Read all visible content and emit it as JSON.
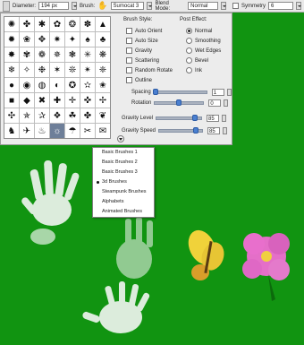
{
  "toolbar": {
    "diameter_label": "Diameter:",
    "diameter_value": "194 px",
    "brush_label": "Brush:",
    "brush_value": "Sumocat 3",
    "blend_label": "Blend Mode:",
    "blend_value": "Normal",
    "symmetry_label": "Symmetry",
    "symmetry_value": "6"
  },
  "panel": {
    "brush_style_label": "Brush Style:",
    "post_effect_label": "Post Effect:",
    "brush_style_options": [
      "Auto Orient",
      "Auto Size",
      "Gravity",
      "Scattering",
      "Random Rotate",
      "Outline"
    ],
    "post_effect_options": [
      "Normal",
      "Smoothing",
      "Wet Edges",
      "Bevel",
      "Ink"
    ],
    "post_effect_selected": "Normal",
    "sliders": [
      {
        "label": "Spacing",
        "value": "1",
        "fraction": 0.02
      },
      {
        "label": "Rotation",
        "value": "0",
        "fraction": 0.5
      },
      {
        "label": "Gravity Level",
        "value": "85",
        "fraction": 0.85
      },
      {
        "label": "Gravity Speed",
        "value": "85",
        "fraction": 0.85
      }
    ],
    "brush_icons": [
      "✺",
      "✤",
      "✱",
      "✿",
      "❂",
      "✽",
      "▲",
      "✹",
      "❀",
      "✥",
      "✷",
      "✦",
      "♠",
      "♣",
      "✸",
      "✾",
      "❁",
      "✵",
      "❃",
      "✳",
      "❋",
      "❄",
      "✧",
      "❉",
      "✶",
      "❊",
      "✴",
      "❈",
      "●",
      "◉",
      "◍",
      "◐",
      "✪",
      "✫",
      "✬",
      "■",
      "◆",
      "✖",
      "✚",
      "✛",
      "✜",
      "✢",
      "✣",
      "✯",
      "✰",
      "❖",
      "☘",
      "✤",
      "❦",
      "♞",
      "✈",
      "♨",
      "☼",
      "☂",
      "✂",
      "✉"
    ],
    "selected_brush_index": 52
  },
  "brush_menu": {
    "items": [
      "Basic Brushes 1",
      "Basic Brushes 2",
      "Basic Brushes 3",
      "3d Brushes",
      "Steampunk Brushes",
      "Alphabets",
      "Animated Brushes"
    ],
    "selected": "3d Brushes"
  },
  "colors": {
    "canvas_green": "#119411",
    "panel_bg": "#ececec",
    "accent": "#4a7fd0"
  }
}
